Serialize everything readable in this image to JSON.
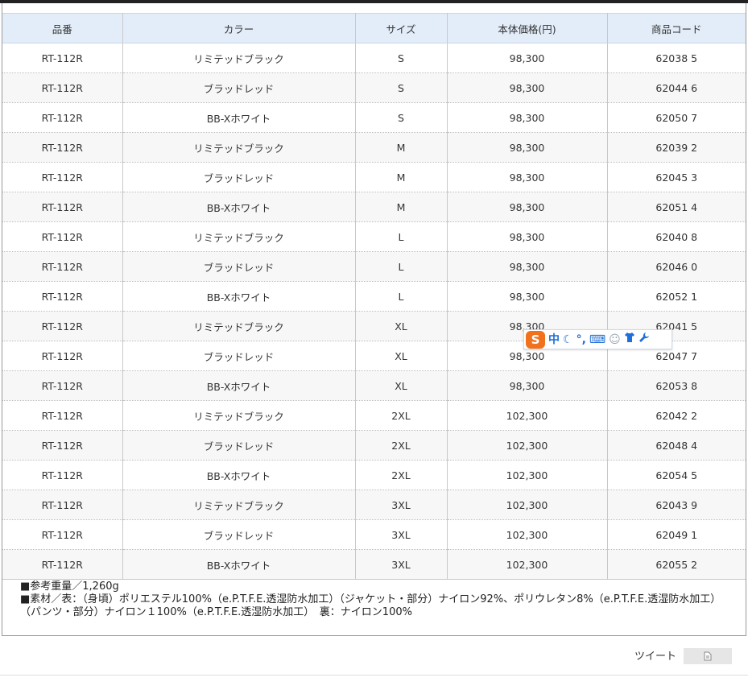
{
  "table": {
    "headers": [
      "品番",
      "カラー",
      "サイズ",
      "本体価格(円)",
      "商品コード"
    ],
    "rows": [
      [
        "RT-112R",
        "リミテッドブラック",
        "S",
        "98,300",
        "62038 5"
      ],
      [
        "RT-112R",
        "ブラッドレッド",
        "S",
        "98,300",
        "62044 6"
      ],
      [
        "RT-112R",
        "BB-Xホワイト",
        "S",
        "98,300",
        "62050 7"
      ],
      [
        "RT-112R",
        "リミテッドブラック",
        "M",
        "98,300",
        "62039 2"
      ],
      [
        "RT-112R",
        "ブラッドレッド",
        "M",
        "98,300",
        "62045 3"
      ],
      [
        "RT-112R",
        "BB-Xホワイト",
        "M",
        "98,300",
        "62051 4"
      ],
      [
        "RT-112R",
        "リミテッドブラック",
        "L",
        "98,300",
        "62040 8"
      ],
      [
        "RT-112R",
        "ブラッドレッド",
        "L",
        "98,300",
        "62046 0"
      ],
      [
        "RT-112R",
        "BB-Xホワイト",
        "L",
        "98,300",
        "62052 1"
      ],
      [
        "RT-112R",
        "リミテッドブラック",
        "XL",
        "98,300",
        "62041 5"
      ],
      [
        "RT-112R",
        "ブラッドレッド",
        "XL",
        "98,300",
        "62047 7"
      ],
      [
        "RT-112R",
        "BB-Xホワイト",
        "XL",
        "98,300",
        "62053 8"
      ],
      [
        "RT-112R",
        "リミテッドブラック",
        "2XL",
        "102,300",
        "62042 2"
      ],
      [
        "RT-112R",
        "ブラッドレッド",
        "2XL",
        "102,300",
        "62048 4"
      ],
      [
        "RT-112R",
        "BB-Xホワイト",
        "2XL",
        "102,300",
        "62054 5"
      ],
      [
        "RT-112R",
        "リミテッドブラック",
        "3XL",
        "102,300",
        "62043 9"
      ],
      [
        "RT-112R",
        "ブラッドレッド",
        "3XL",
        "102,300",
        "62049 1"
      ],
      [
        "RT-112R",
        "BB-Xホワイト",
        "3XL",
        "102,300",
        "62055 2"
      ]
    ]
  },
  "notes": {
    "weight": "■参考重量／1,260g",
    "material": "■素材／表：（身頃）ポリエステル100%（e.P.T.F.E.透湿防水加工）（ジャケット・部分）ナイロン92%、ポリウレタン8%（e.P.T.F.E.透湿防水加工）（パンツ・部分）ナイロン１100%（e.P.T.F.E.透湿防水加工）　裏：ナイロン100%"
  },
  "ime_toolbar": {
    "logo": "S",
    "mode": "中",
    "icons": [
      "moon-icon",
      "punctuation-icon",
      "keyboard-icon",
      "user-icon",
      "shirt-icon",
      "wrench-icon"
    ]
  },
  "share": {
    "tweet_label": "ツイート",
    "button_icon": "document-icon"
  },
  "colors": {
    "header_bg": "#e3edf9",
    "stripe_bg": "#f7f7f7",
    "ime_logo": "#f2711c",
    "ime_icon": "#1e6fd8"
  }
}
